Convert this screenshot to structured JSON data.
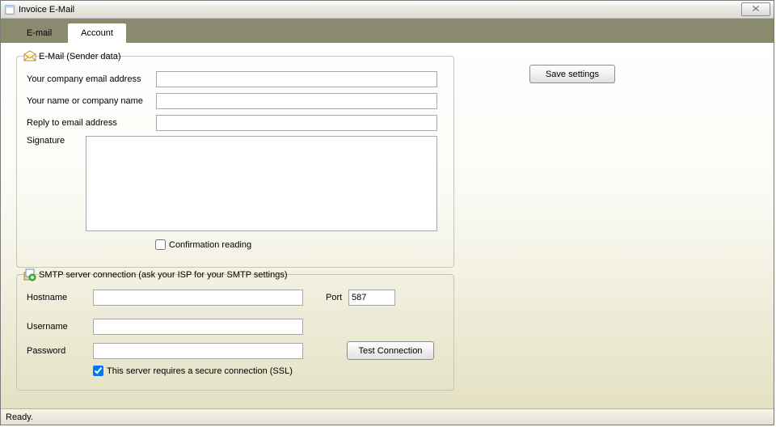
{
  "window": {
    "title": "Invoice E-Mail"
  },
  "tabs": {
    "email": "E-mail",
    "account": "Account"
  },
  "group_sender": {
    "legend": "E-Mail (Sender data)",
    "company_email_label": "Your company email address",
    "company_email_value": "",
    "name_label": "Your name or company name",
    "name_value": "",
    "reply_label": "Reply to email address",
    "reply_value": "",
    "signature_label": "Signature",
    "signature_value": "",
    "confirmation_label": "Confirmation reading",
    "confirmation_checked": false
  },
  "group_smtp": {
    "legend": "SMTP server connection (ask your ISP for your SMTP settings)",
    "hostname_label": "Hostname",
    "hostname_value": "",
    "port_label": "Port",
    "port_value": "587",
    "username_label": "Username",
    "username_value": "",
    "password_label": "Password",
    "password_value": "",
    "test_button": "Test Connection",
    "ssl_label": "This server requires a secure connection (SSL)",
    "ssl_checked": true
  },
  "buttons": {
    "save": "Save settings"
  },
  "status": {
    "text": "Ready."
  }
}
